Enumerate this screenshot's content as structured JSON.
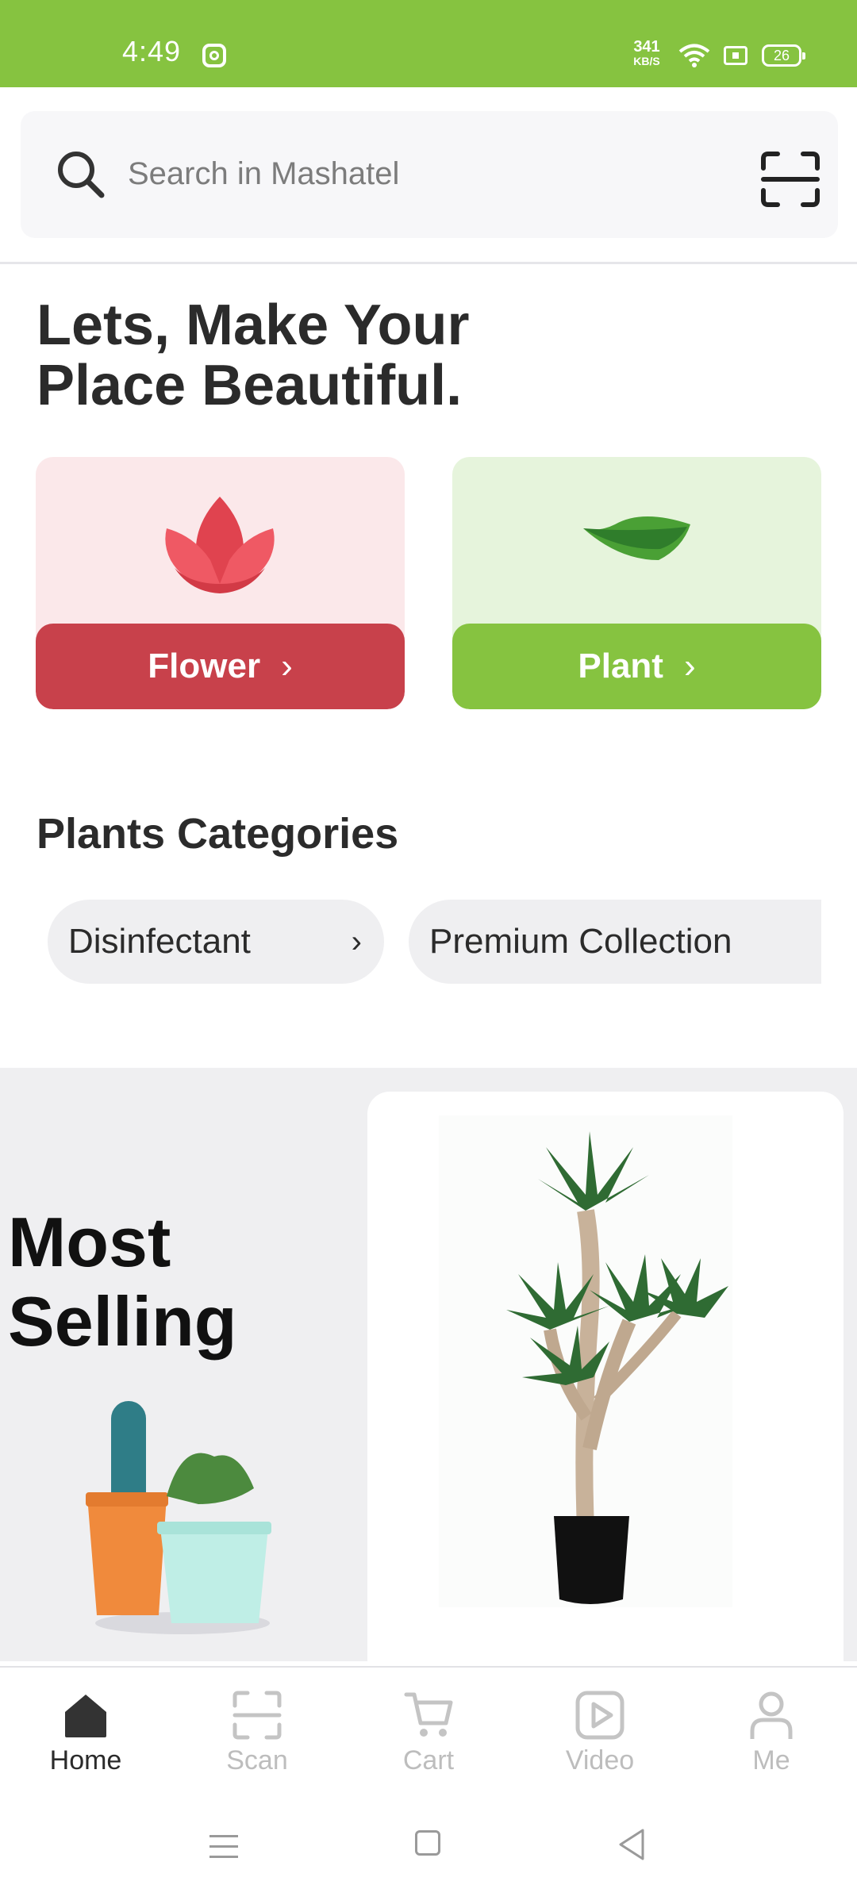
{
  "status_bar": {
    "time": "4:49",
    "speed_value": "341",
    "speed_unit": "KB/S",
    "battery": "26",
    "bg_color": "#86c340"
  },
  "search": {
    "placeholder": "Search in Mashatel",
    "icon": "search-icon",
    "scan_icon": "scan-icon"
  },
  "hero": {
    "title_line1": "Lets, Make Your",
    "title_line2": "Place Beautiful.",
    "cards": [
      {
        "label": "Flower",
        "icon": "lotus-icon",
        "color": "#c8414b"
      },
      {
        "label": "Plant",
        "icon": "leaf-icon",
        "color": "#86c340"
      }
    ]
  },
  "categories": {
    "title": "Plants Categories",
    "chips": [
      "Disinfectant",
      "Premium Collection"
    ]
  },
  "most_selling": {
    "title_line1": "Most",
    "title_line2": "Selling"
  },
  "bottom_nav": {
    "items": [
      {
        "label": "Home",
        "icon": "home-icon",
        "active": true
      },
      {
        "label": "Scan",
        "icon": "scan-icon",
        "active": false
      },
      {
        "label": "Cart",
        "icon": "cart-icon",
        "active": false
      },
      {
        "label": "Video",
        "icon": "video-icon",
        "active": false
      },
      {
        "label": "Me",
        "icon": "user-icon",
        "active": false
      }
    ]
  }
}
